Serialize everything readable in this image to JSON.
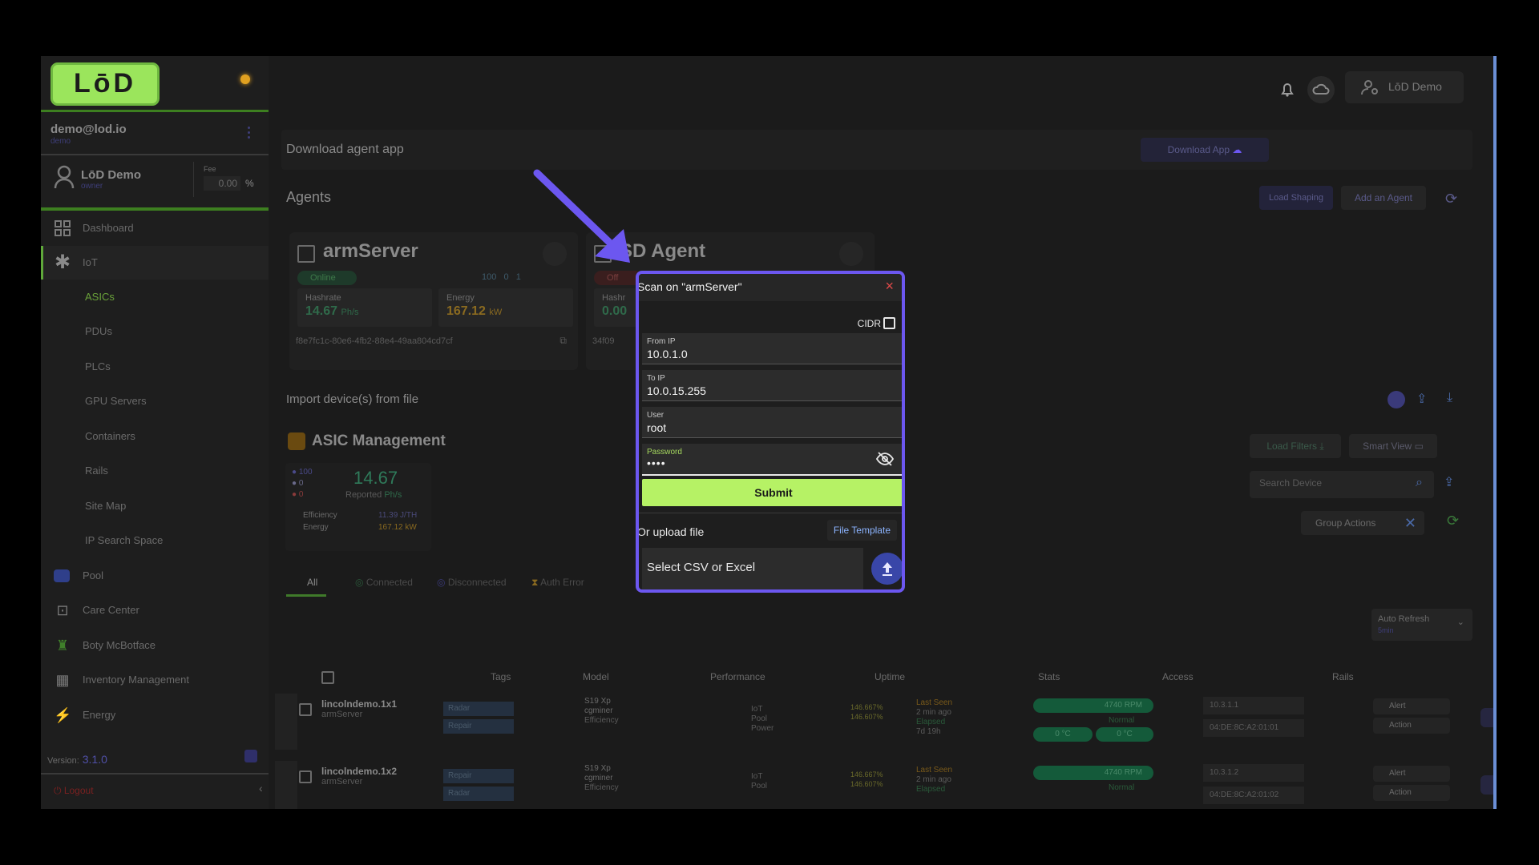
{
  "sidebar": {
    "logo": "LōD",
    "email": "demo@lod.io",
    "email_sub": "demo",
    "user_name": "LōD Demo",
    "user_role": "owner",
    "fee_label": "Fee",
    "fee_value": "0.00",
    "fee_unit": "%",
    "nav": [
      {
        "label": "Dashboard",
        "icon": "grid-icon"
      },
      {
        "label": "IoT",
        "icon": "asterisk-icon"
      },
      {
        "label": "ASICs"
      },
      {
        "label": "PDUs"
      },
      {
        "label": "PLCs"
      },
      {
        "label": "GPU Servers"
      },
      {
        "label": "Containers"
      },
      {
        "label": "Rails"
      },
      {
        "label": "Site Map"
      },
      {
        "label": "IP Search Space"
      },
      {
        "label": "Pool",
        "icon": "pool-icon"
      },
      {
        "label": "Care Center",
        "icon": "briefcase-icon"
      },
      {
        "label": "Boty McBotface",
        "icon": "robot-icon"
      },
      {
        "label": "Inventory Management",
        "icon": "qr-icon"
      },
      {
        "label": "Energy",
        "icon": "bolt-icon"
      }
    ],
    "version_label": "Version:",
    "version": "3.1.0",
    "logout": "Logout"
  },
  "header": {
    "user_button": "LōD Demo"
  },
  "download": {
    "title": "Download agent app",
    "button": "Download App"
  },
  "agents": {
    "title": "Agents",
    "load_shaping": "Load Shaping",
    "add_agent": "Add an Agent",
    "cards": [
      {
        "name": "armServer",
        "status": "Online",
        "counts": "100   0   1",
        "hashrate_label": "Hashrate",
        "hashrate": "14.67",
        "hashrate_unit": "Ph/s",
        "energy_label": "Energy",
        "energy": "167.12",
        "energy_unit": "kW",
        "id": "f8e7fc1c-80e6-4fb2-88e4-49aa804cd7cf"
      },
      {
        "name": "SD Agent",
        "status": "Off",
        "hashrate_label": "Hashr",
        "hashrate": "0.00",
        "id": "34f09"
      }
    ]
  },
  "import": {
    "title": "Import device(s) from file"
  },
  "asic": {
    "title": "ASIC Management",
    "legend": [
      "100",
      "0",
      "0"
    ],
    "hashrate": "14.67",
    "hashrate_label": "Reported",
    "hashrate_unit": "Ph/s",
    "efficiency_label": "Efficiency",
    "efficiency": "11.39 J/TH",
    "energy_label": "Energy",
    "energy": "167.12 kW",
    "load_filters": "Load Filters",
    "smart_view": "Smart View",
    "search_placeholder": "Search Device",
    "group_actions": "Group Actions",
    "auto_refresh": "Auto Refresh",
    "auto_refresh_value": "5min"
  },
  "tabs": [
    "All",
    "Connected",
    "Disconnected",
    "Auth Error"
  ],
  "table": {
    "headers": [
      "Tags",
      "Model",
      "Performance",
      "Uptime",
      "Stats",
      "Access",
      "Rails"
    ],
    "rows": [
      {
        "name": "lincolndemo.1x1",
        "agent": "armServer",
        "tags": [
          "Radar",
          "Repair"
        ],
        "model": "S19 Xp",
        "firmware": "cgminer",
        "perf_iot": "146.667%",
        "perf_pool": "146.607%",
        "uptime_label": "Last Seen",
        "uptime": "2 min ago",
        "elapsed_label": "Elapsed",
        "elapsed": "7d 19h",
        "rpm": "4740 RPM",
        "status": "Normal",
        "temp1": "0 °C",
        "temp2": "0 °C",
        "ip": "10.3.1.1",
        "mac": "04:DE:8C:A2:01:01",
        "alert": "Alert",
        "action": "Action"
      },
      {
        "name": "lincolndemo.1x2",
        "agent": "armServer",
        "tags": [
          "Repair",
          "Radar"
        ],
        "model": "S19 Xp",
        "firmware": "cgminer",
        "perf_iot": "146.667%",
        "perf_pool": "146.607%",
        "uptime_label": "Last Seen",
        "uptime": "2 min ago",
        "elapsed_label": "Elapsed",
        "elapsed": "7d 19h",
        "rpm": "4740 RPM",
        "status": "Normal",
        "ip": "10.3.1.2",
        "mac": "04:DE:8C:A2:01:02",
        "alert": "Alert",
        "action": "Action"
      }
    ],
    "perf_labels": [
      "IoT",
      "Pool",
      "Power"
    ],
    "model_sub": "Efficiency"
  },
  "dialog": {
    "title": "Scan on \"armServer\"",
    "close": "×",
    "cidr_label": "CIDR",
    "from_ip_label": "From IP",
    "from_ip": "10.0.1.0",
    "to_ip_label": "To IP",
    "to_ip": "10.0.15.255",
    "user_label": "User",
    "user": "root",
    "password_label": "Password",
    "password": "••••",
    "submit": "Submit",
    "upload_label": "Or upload file",
    "file_template": "File Template",
    "file_placeholder": "Select CSV or Excel"
  },
  "colors": {
    "accent": "#6c57f0",
    "submit": "#b6f265",
    "brand_green": "#9be55c",
    "close": "#e24a4a"
  }
}
